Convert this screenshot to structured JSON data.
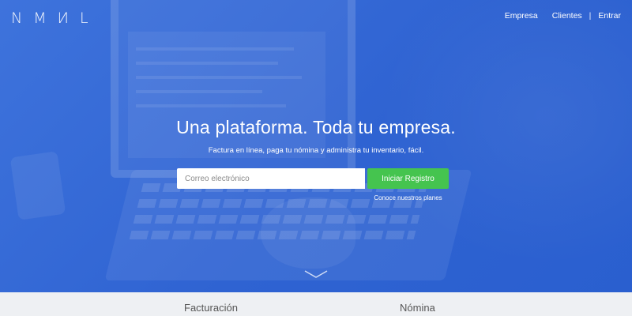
{
  "header": {
    "logo_letters": [
      "N",
      "M",
      "И",
      "L"
    ],
    "nav": {
      "empresa": "Empresa",
      "clientes": "Clientes",
      "separator": "|",
      "entrar": "Entrar"
    }
  },
  "hero": {
    "headline": "Una plataforma. Toda tu empresa.",
    "subheadline": "Factura en línea, paga tu nómina y administra tu inventario, fácil.",
    "email_placeholder": "Correo electrónico",
    "register_label": "Iniciar Registro",
    "plans_link": "Conoce nuestros planes",
    "scroll_icon": "chevron-down-icon"
  },
  "bottom_tabs": {
    "facturacion": "Facturación",
    "nomina": "Nómina"
  },
  "colors": {
    "hero_blue": "#2f63d2",
    "register_green": "#45c44f",
    "bottom_bar": "#eef0f3"
  }
}
